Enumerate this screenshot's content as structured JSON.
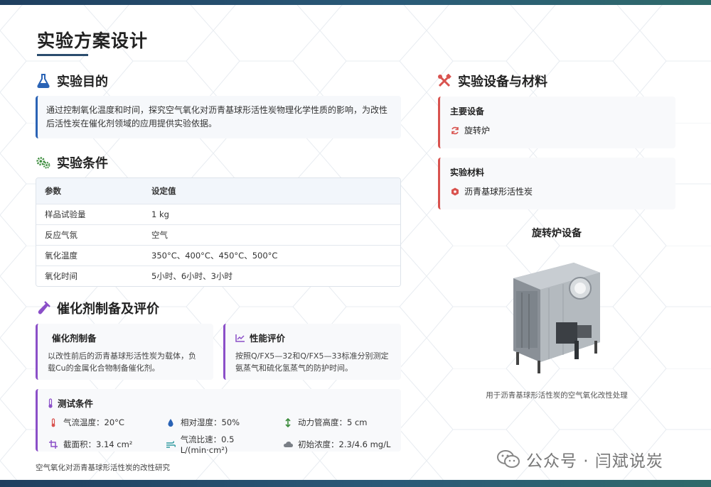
{
  "title": "实验方案设计",
  "goal": {
    "heading": "实验目的",
    "text": "通过控制氧化温度和时间，探究空气氧化对沥青基球形活性炭物理化学性质的影响，为改性后活性炭在催化剂领域的应用提供实验依据。"
  },
  "conditions": {
    "heading": "实验条件",
    "header": [
      "参数",
      "设定值"
    ],
    "rows": [
      [
        "样品试验量",
        "1 kg"
      ],
      [
        "反应气氛",
        "空气"
      ],
      [
        "氧化温度",
        "350°C、400°C、450°C、500°C"
      ],
      [
        "氧化时间",
        "5小时、6小时、3小时"
      ]
    ]
  },
  "catalyst": {
    "heading": "催化剂制备及评价",
    "prep_title": "催化剂制备",
    "prep_text": "以改性前后的沥青基球形活性炭为载体，负载Cu的金属化合物制备催化剂。",
    "eval_title": "性能评价",
    "eval_text": "按照Q/FX5—32和Q/FX5—33标准分别测定氨蒸气和硫化氢蒸气的防护时间。",
    "test_title": "测试条件",
    "test_items": [
      {
        "label": "气流温度：20°C",
        "icon": "thermometer-icon"
      },
      {
        "label": "相对湿度：50%",
        "icon": "droplet-icon"
      },
      {
        "label": "动力管高度：5 cm",
        "icon": "height-arrows-icon"
      },
      {
        "label": "截面积：3.14 cm²",
        "icon": "crop-area-icon"
      },
      {
        "label": "气流比速：0.5 L/(min·cm²)",
        "icon": "wind-icon"
      },
      {
        "label": "初始浓度：2.3/4.6 mg/L",
        "icon": "cloud-icon"
      }
    ]
  },
  "footnote": "空气氧化对沥青基球形活性炭的改性研究",
  "equipment": {
    "heading": "实验设备与材料",
    "main_title": "主要设备",
    "main_item": "旋转炉",
    "material_title": "实验材料",
    "material_item": "沥青基球形活性炭",
    "image_title": "旋转炉设备",
    "caption": "用于沥青基球形活性炭的空气氧化改性处理"
  },
  "watermark": "公众号 · 闫斌说炭",
  "colors": {
    "accent_blue": "#2a63b5",
    "accent_purple": "#8b4fc8",
    "accent_red": "#d9534f",
    "accent_green": "#3c8c3c",
    "bar": "#1f3f5f"
  }
}
